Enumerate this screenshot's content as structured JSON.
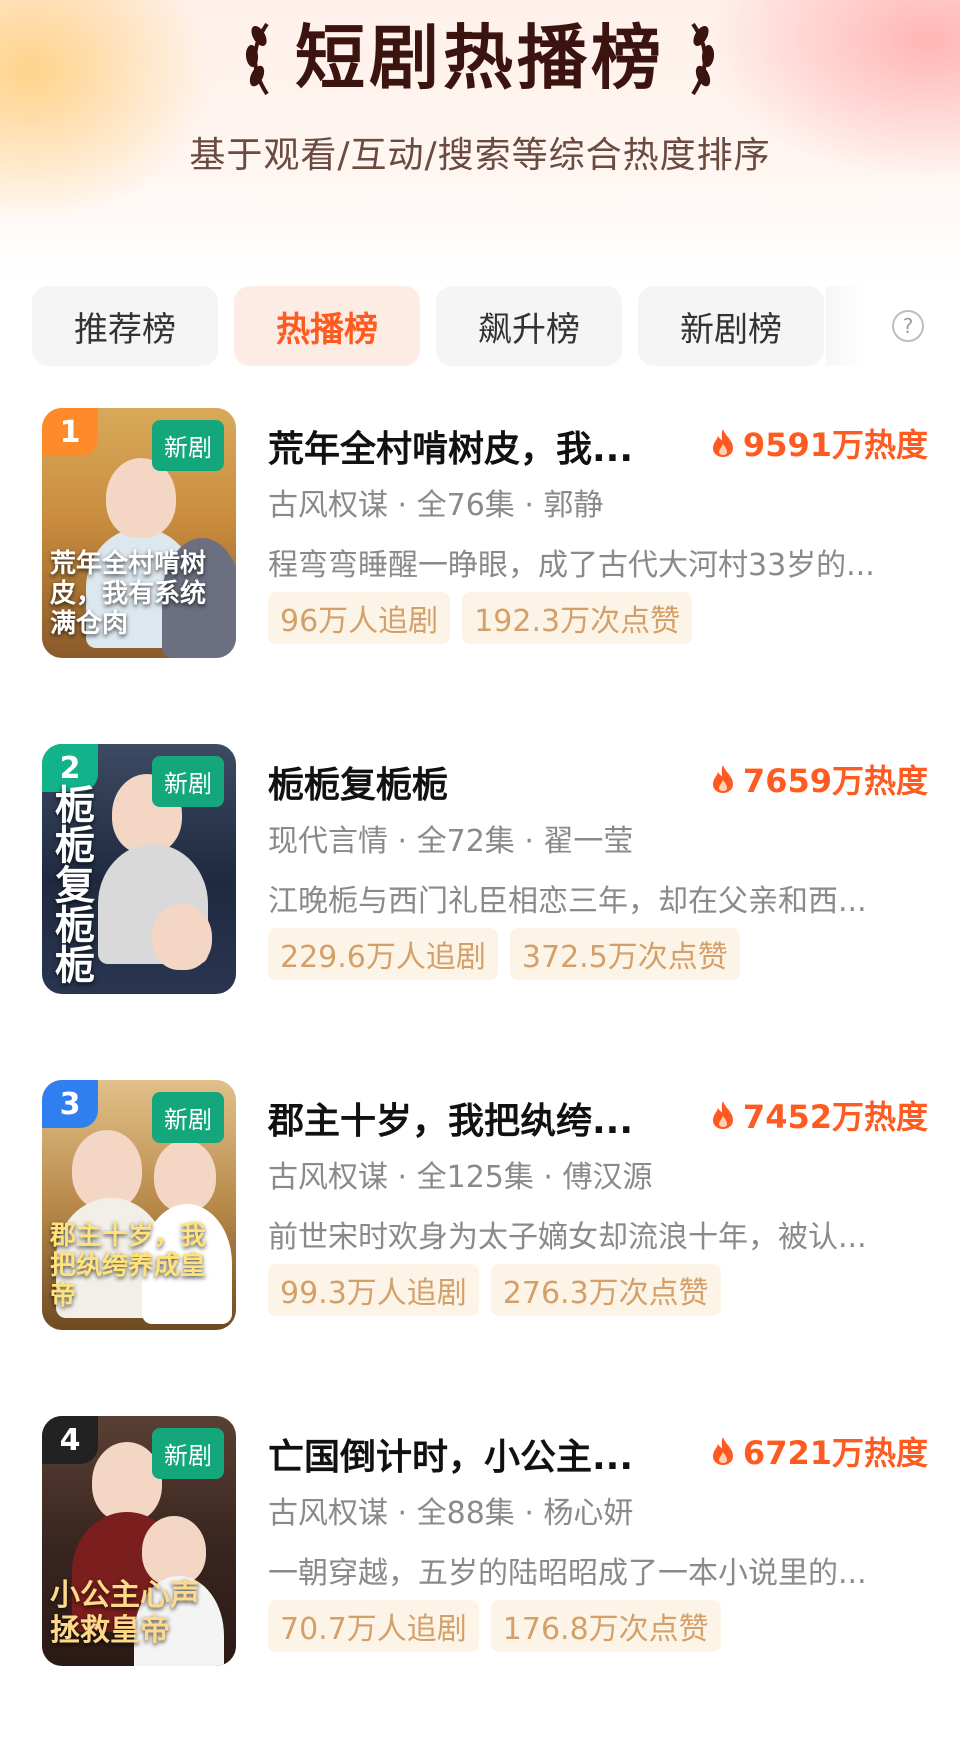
{
  "header": {
    "title": "短剧热播榜",
    "subtitle": "基于观看/互动/搜索等综合热度排序"
  },
  "tabs": [
    {
      "label": "推荐榜",
      "active": false
    },
    {
      "label": "热播榜",
      "active": true
    },
    {
      "label": "飙升榜",
      "active": false
    },
    {
      "label": "新剧榜",
      "active": false
    }
  ],
  "help_icon": "question-circle-icon",
  "colors": {
    "accent": "#ff5a1f",
    "new_tag": "#14a77c",
    "chip_bg": "#fdf4e8",
    "chip_text": "#d4a06a",
    "rank1": "#ff8a2a",
    "rank2": "#12b38a",
    "rank3": "#2f7ff0",
    "rank4": "#222222"
  },
  "items": [
    {
      "rank": "1",
      "badge": "新剧",
      "poster_text": "荒年全村啃树皮，我有系统满仓肉",
      "title": "荒年全村啃树皮，我...",
      "heat": "9591万热度",
      "meta": "古风权谋 · 全76集 · 郭静",
      "desc": "程弯弯睡醒一睁眼，成了古代大河村33岁的...",
      "chips": [
        "96万人追剧",
        "192.3万次点赞"
      ]
    },
    {
      "rank": "2",
      "badge": "新剧",
      "poster_text": "栀栀复栀栀",
      "title": "栀栀复栀栀",
      "heat": "7659万热度",
      "meta": "现代言情 · 全72集 · 翟一莹",
      "desc": "江晚栀与西门礼臣相恋三年，却在父亲和西...",
      "chips": [
        "229.6万人追剧",
        "372.5万次点赞"
      ]
    },
    {
      "rank": "3",
      "badge": "新剧",
      "poster_text": "郡主十岁，我把纨绔养成皇帝",
      "title": "郡主十岁，我把纨绔...",
      "heat": "7452万热度",
      "meta": "古风权谋 · 全125集 · 傅汉源",
      "desc": "前世宋时欢身为太子嫡女却流浪十年，被认...",
      "chips": [
        "99.3万人追剧",
        "276.3万次点赞"
      ]
    },
    {
      "rank": "4",
      "badge": "新剧",
      "poster_text": "小公主心声拯救皇帝",
      "title": "亡国倒计时，小公主...",
      "heat": "6721万热度",
      "meta": "古风权谋 · 全88集 · 杨心妍",
      "desc": "一朝穿越，五岁的陆昭昭成了一本小说里的...",
      "chips": [
        "70.7万人追剧",
        "176.8万次点赞"
      ]
    }
  ]
}
